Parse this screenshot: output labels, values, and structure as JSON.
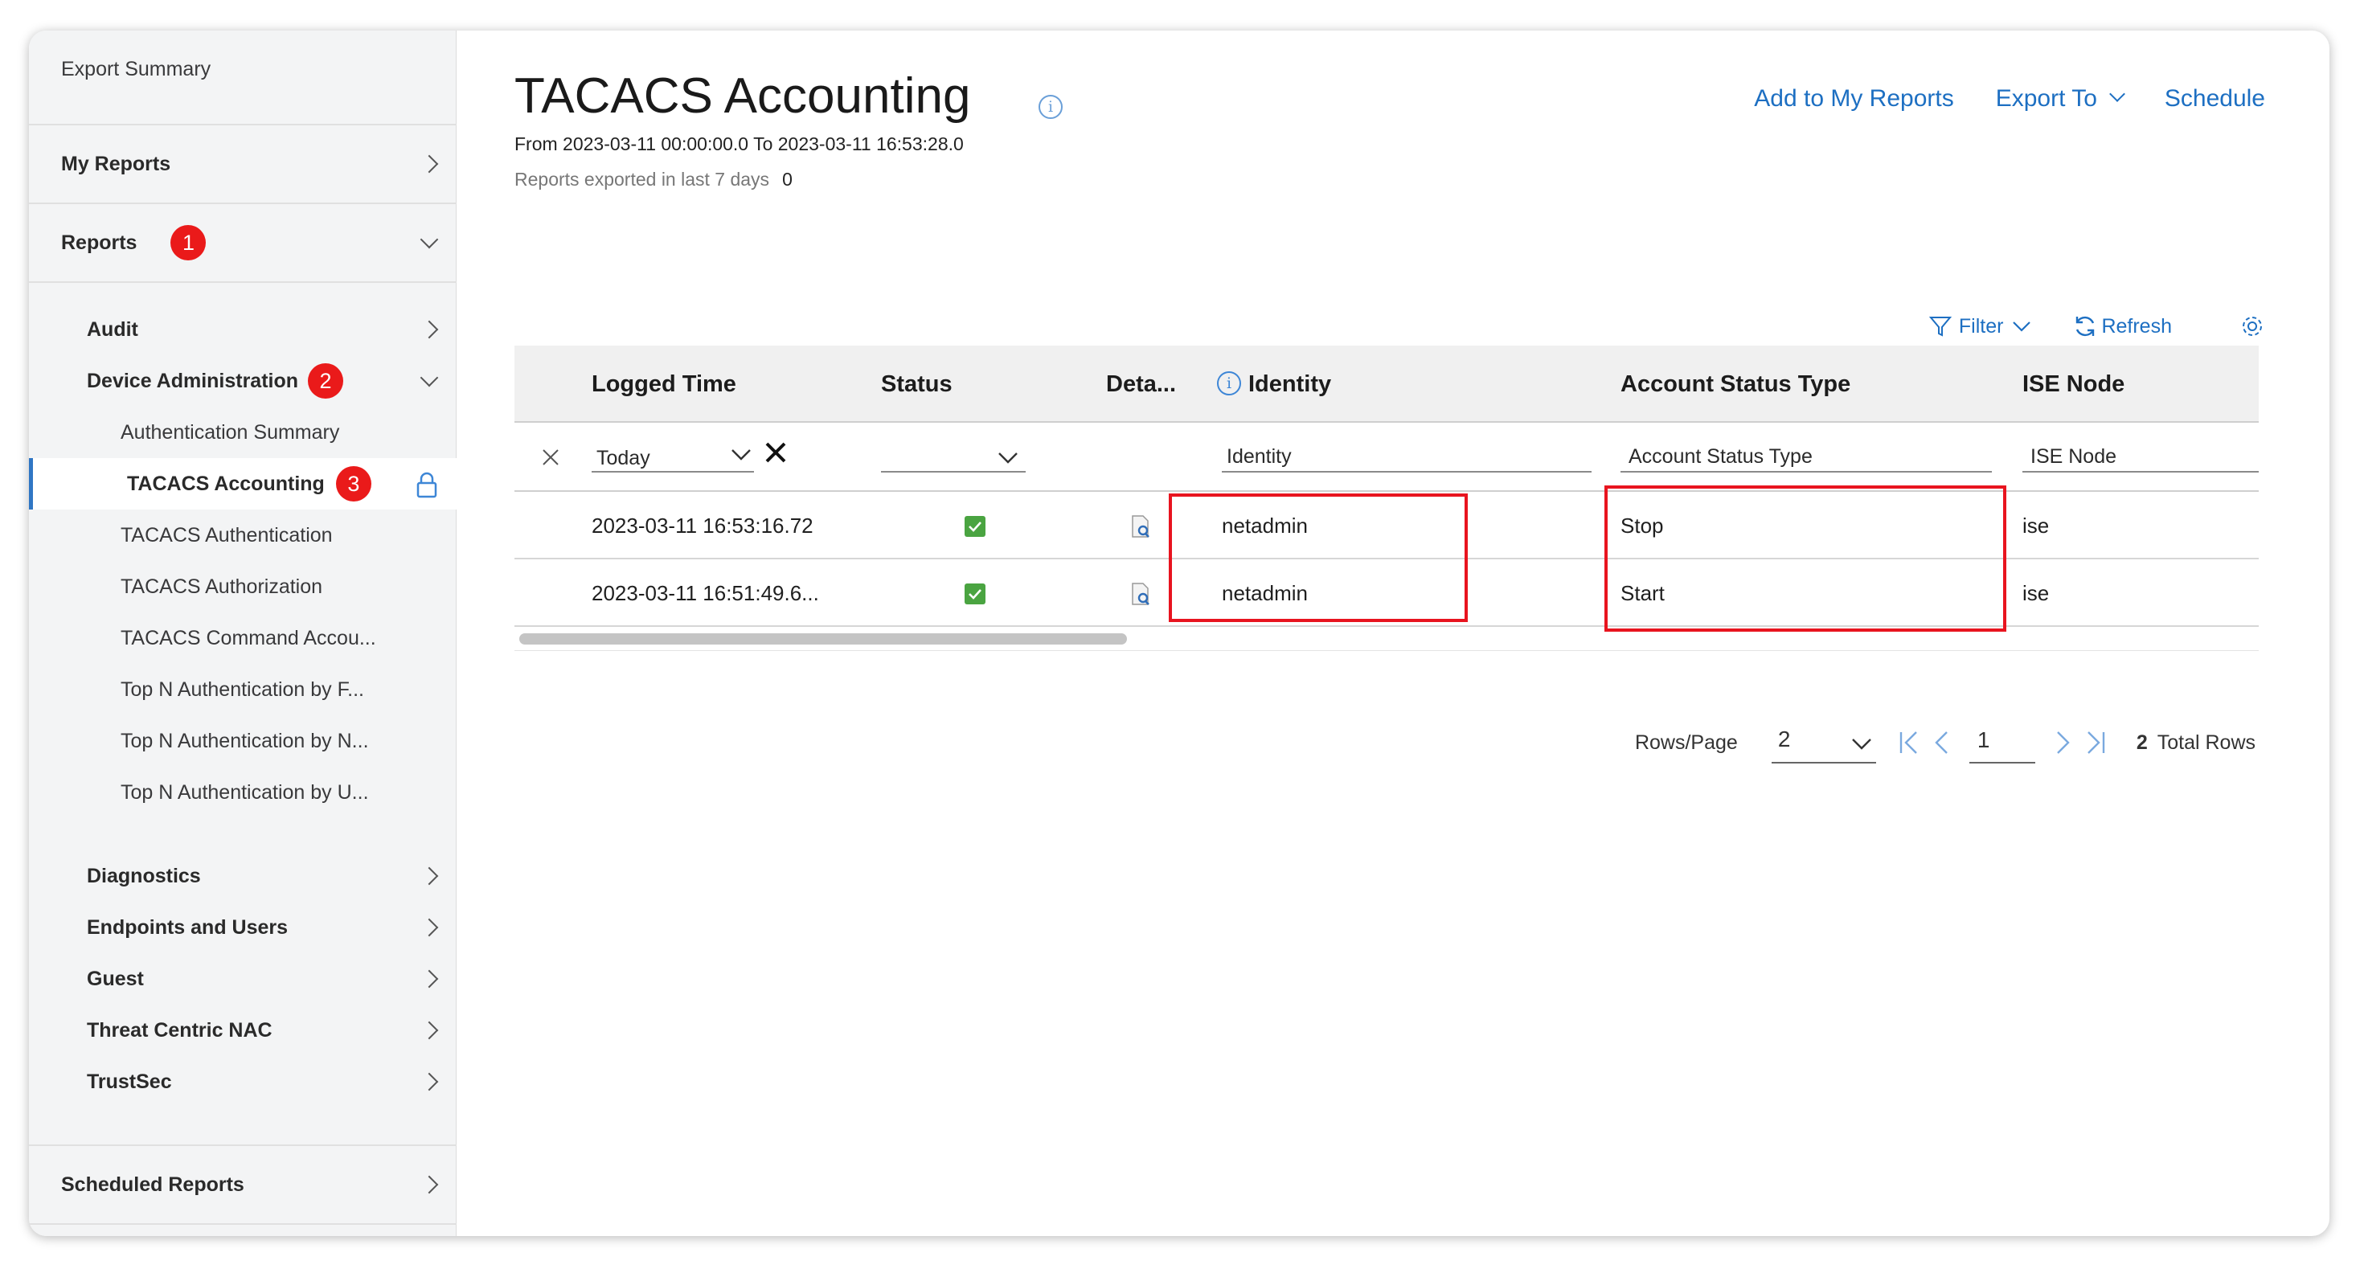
{
  "sidebar": {
    "export_summary": "Export Summary",
    "my_reports": "My Reports",
    "reports": "Reports",
    "reports_badge": "1",
    "audit": "Audit",
    "device_admin": "Device Administration",
    "device_admin_badge": "2",
    "sub_items": [
      "Authentication Summary",
      "TACACS Accounting",
      "TACACS Authentication",
      "TACACS Authorization",
      "TACACS Command Accou...",
      "Top N Authentication by F...",
      "Top N Authentication by N...",
      "Top N Authentication by U..."
    ],
    "active_badge": "3",
    "sections": [
      "Diagnostics",
      "Endpoints and Users",
      "Guest",
      "Threat Centric NAC",
      "TrustSec"
    ],
    "scheduled_reports": "Scheduled Reports"
  },
  "header": {
    "title": "TACACS Accounting",
    "date_range": "From 2023-03-11 00:00:00.0 To 2023-03-11 16:53:28.0",
    "exported_label": "Reports exported in last 7 days",
    "exported_value": "0",
    "add_to_reports": "Add to My Reports",
    "export_to": "Export To",
    "schedule": "Schedule"
  },
  "toolbar": {
    "filter": "Filter",
    "refresh": "Refresh"
  },
  "table": {
    "headers": {
      "logged_time": "Logged Time",
      "status": "Status",
      "details": "Deta...",
      "identity": "Identity",
      "account_status_type": "Account Status Type",
      "ise_node": "ISE Node"
    },
    "filters": {
      "logged_time": "Today",
      "identity": "Identity",
      "account_status_type": "Account Status Type",
      "ise_node": "ISE Node"
    },
    "rows": [
      {
        "logged_time": "2023-03-11 16:53:16.72",
        "identity": "netadmin",
        "account_status_type": "Stop",
        "ise_node": "ise"
      },
      {
        "logged_time": "2023-03-11 16:51:49.6...",
        "identity": "netadmin",
        "account_status_type": "Start",
        "ise_node": "ise"
      }
    ]
  },
  "pager": {
    "rows_per_page_label": "Rows/Page",
    "rows_per_page": "2",
    "current_page": "1",
    "total_rows": "2",
    "total_label": "Total Rows"
  },
  "colors": {
    "accent": "#1d6fc2",
    "badge": "#ea1a1a",
    "highlight": "#e8141f",
    "success": "#4aa441"
  }
}
